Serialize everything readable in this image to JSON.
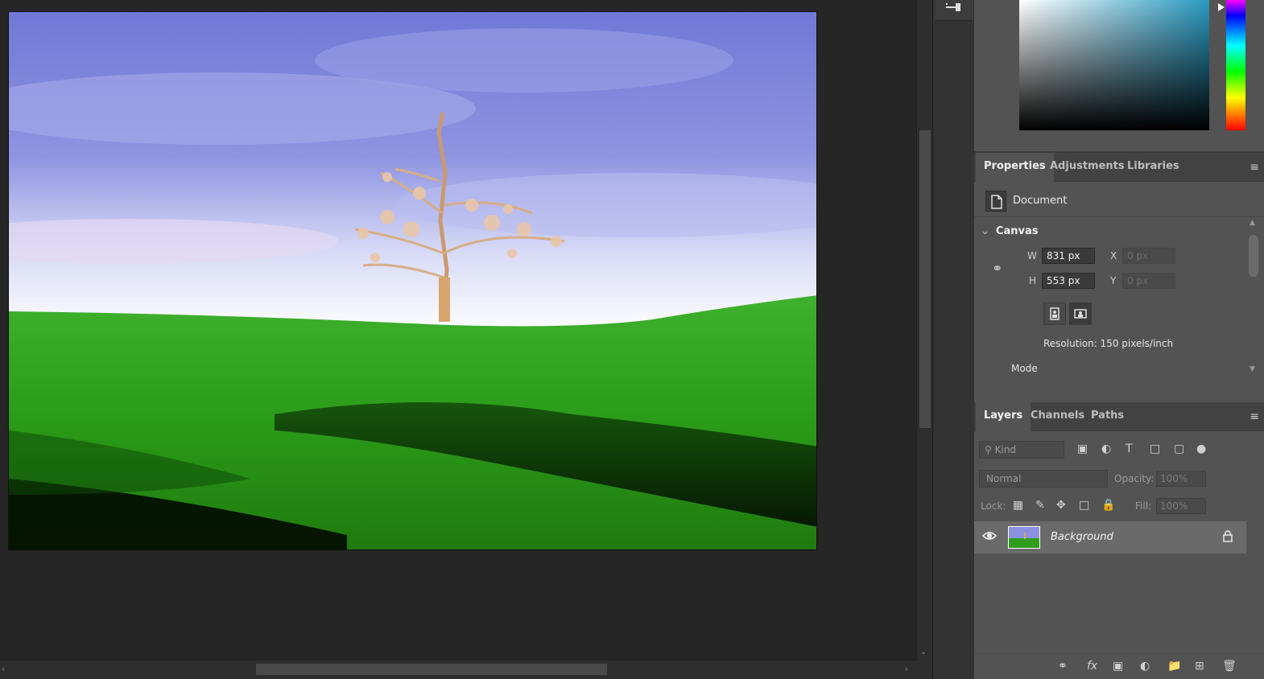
{
  "canvas": {
    "image_alt": "Green rolling hill with a lone bare tree under a blue cloudy sky"
  },
  "toolstrip": {
    "top_tool_icon": "properties-toggle-icon"
  },
  "properties_tabs": [
    {
      "label": "Properties",
      "active": true
    },
    {
      "label": "Adjustments",
      "active": false
    },
    {
      "label": "Libraries",
      "active": false
    }
  ],
  "properties": {
    "document_label": "Document",
    "canvas_section": "Canvas",
    "w_label": "W",
    "w_value": "831 px",
    "h_label": "H",
    "h_value": "553 px",
    "x_label": "X",
    "x_value": "0 px",
    "y_label": "Y",
    "y_value": "0 px",
    "resolution": "Resolution: 150 pixels/inch",
    "mode_label": "Mode"
  },
  "layers_tabs": [
    {
      "label": "Layers",
      "active": true
    },
    {
      "label": "Channels",
      "active": false
    },
    {
      "label": "Paths",
      "active": false
    }
  ],
  "layers": {
    "kind_placeholder": "Kind",
    "blend_mode": "Normal",
    "opacity_label": "Opacity:",
    "opacity_value": "100%",
    "lock_label": "Lock:",
    "fill_label": "Fill:",
    "fill_value": "100%",
    "items": [
      {
        "name": "Background",
        "visible": true,
        "locked": true
      }
    ]
  },
  "colors": {
    "workspace": "#262626",
    "panel": "#535353",
    "tabbar": "#424242",
    "selected_layer": "#6a6a6a"
  }
}
